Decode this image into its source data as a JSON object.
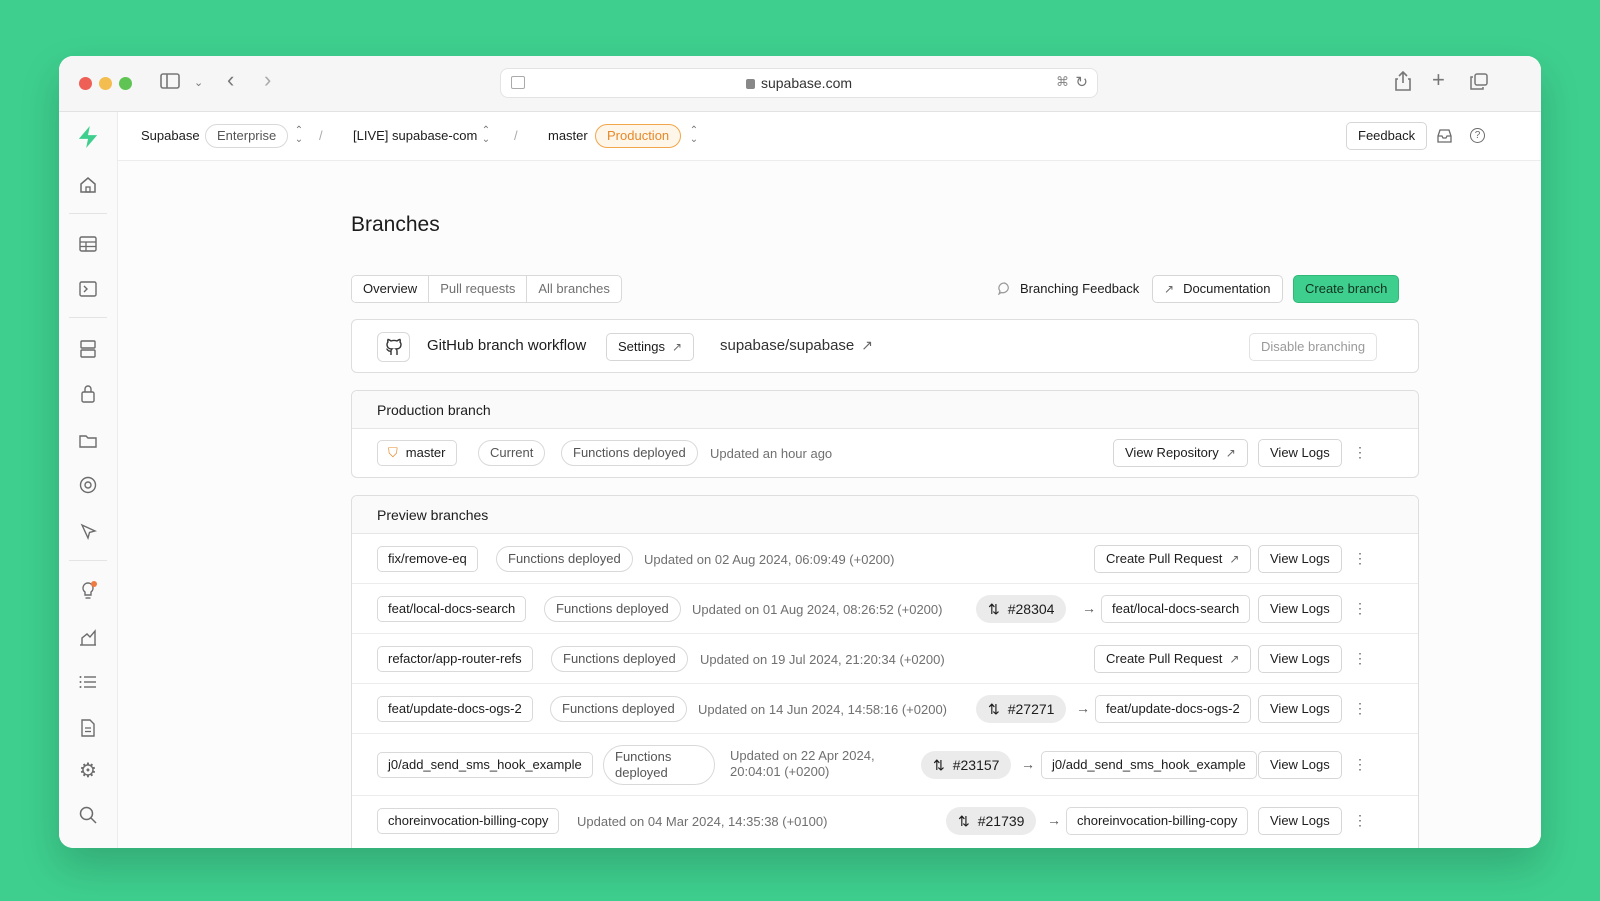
{
  "browser": {
    "url": "supabase.com"
  },
  "topbar": {
    "org": "Supabase",
    "plan": "Enterprise",
    "project": "[LIVE] supabase-com",
    "branch": "master",
    "env": "Production",
    "feedback": "Feedback",
    "separator": "/"
  },
  "page": {
    "title": "Branches"
  },
  "tabs": [
    "Overview",
    "Pull requests",
    "All branches"
  ],
  "actions": {
    "branching_feedback": "Branching Feedback",
    "documentation": "Documentation",
    "create_branch": "Create branch"
  },
  "github": {
    "title": "GitHub branch workflow",
    "settings": "Settings",
    "repo": "supabase/supabase",
    "disable": "Disable branching"
  },
  "production": {
    "heading": "Production branch",
    "name": "master",
    "current": "Current",
    "status": "Functions deployed",
    "updated": "Updated an hour ago",
    "view_repo": "View Repository",
    "view_logs": "View Logs"
  },
  "preview": {
    "heading": "Preview branches",
    "rows": [
      {
        "name": "fix/remove-eq",
        "status": "Functions deployed",
        "updated": "Updated on 02 Aug 2024, 06:09:49 (+0200)",
        "action": "Create Pull Request",
        "view_logs": "View Logs"
      },
      {
        "name": "feat/local-docs-search",
        "status": "Functions deployed",
        "updated": "Updated on 01 Aug 2024, 08:26:52 (+0200)",
        "pr": "#28304",
        "target": "feat/local-docs-search",
        "view_logs": "View Logs"
      },
      {
        "name": "refactor/app-router-refs",
        "status": "Functions deployed",
        "updated": "Updated on 19 Jul 2024, 21:20:34 (+0200)",
        "action": "Create Pull Request",
        "view_logs": "View Logs"
      },
      {
        "name": "feat/update-docs-ogs-2",
        "status": "Functions deployed",
        "updated": "Updated on 14 Jun 2024, 14:58:16 (+0200)",
        "pr": "#27271",
        "target": "feat/update-docs-ogs-2",
        "view_logs": "View Logs"
      },
      {
        "name": "j0/add_send_sms_hook_example",
        "status_line1": "Functions",
        "status_line2": "deployed",
        "updated_line1": "Updated on 22 Apr 2024,",
        "updated_line2": "20:04:01 (+0200)",
        "pr": "#23157",
        "target": "j0/add_send_sms_hook_example",
        "view_logs": "View Logs"
      },
      {
        "name": "choreinvocation-billing-copy",
        "updated": "Updated on 04 Mar 2024, 14:35:38 (+0100)",
        "pr": "#21739",
        "target": "choreinvocation-billing-copy",
        "view_logs": "View Logs"
      }
    ]
  },
  "colors": {
    "brand": "#3ecf8e",
    "background": "#3ecf8e",
    "production_badge": "#e5892a"
  },
  "icons": [
    "sidebar-toggle-icon",
    "chevron-left-icon",
    "chevron-right-icon",
    "share-icon",
    "plus-icon",
    "tabs-icon",
    "supabase-logo",
    "home-icon",
    "table-editor-icon",
    "sql-editor-icon",
    "database-icon",
    "auth-icon",
    "storage-icon",
    "edge-functions-icon",
    "realtime-icon",
    "advisors-icon",
    "reports-icon",
    "logs-icon",
    "api-docs-icon",
    "settings-icon",
    "search-icon",
    "github-icon",
    "external-link-icon",
    "kebab-icon",
    "pull-request-icon",
    "shield-icon"
  ]
}
